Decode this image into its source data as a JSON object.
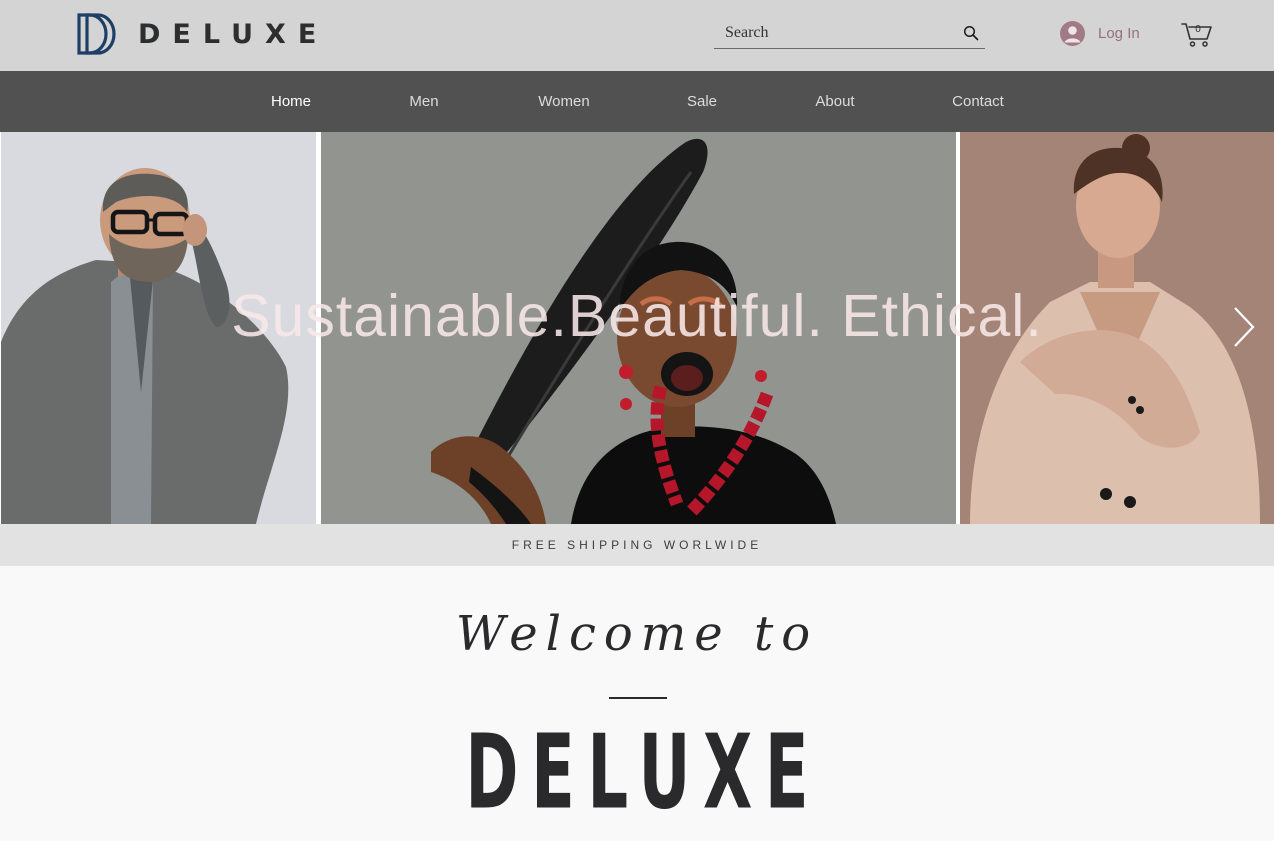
{
  "header": {
    "brand": "DELUXE",
    "search_placeholder": "Search",
    "login_label": "Log In",
    "cart_count": "0"
  },
  "nav": {
    "items": [
      {
        "label": "Home",
        "active": true
      },
      {
        "label": "Men"
      },
      {
        "label": "Women"
      },
      {
        "label": "Sale"
      },
      {
        "label": "About"
      },
      {
        "label": "Contact"
      }
    ]
  },
  "hero": {
    "headline": "Sustainable.Beautiful. Ethical."
  },
  "banner": {
    "shipping_text": "FREE SHIPPING WORLWIDE"
  },
  "welcome": {
    "heading": "Welcome to",
    "brand": "DELUXE"
  },
  "icons": {
    "logo": "dd-monogram-icon",
    "search": "search-icon",
    "user": "user-avatar-icon",
    "cart": "cart-icon",
    "next": "chevron-right-icon"
  },
  "colors": {
    "header_bg": "#d4d4d4",
    "nav_bg": "#525151",
    "login_accent": "#9a6f7b",
    "logo_blue": "#1d3f66",
    "text_dark": "#2a2a2d"
  }
}
